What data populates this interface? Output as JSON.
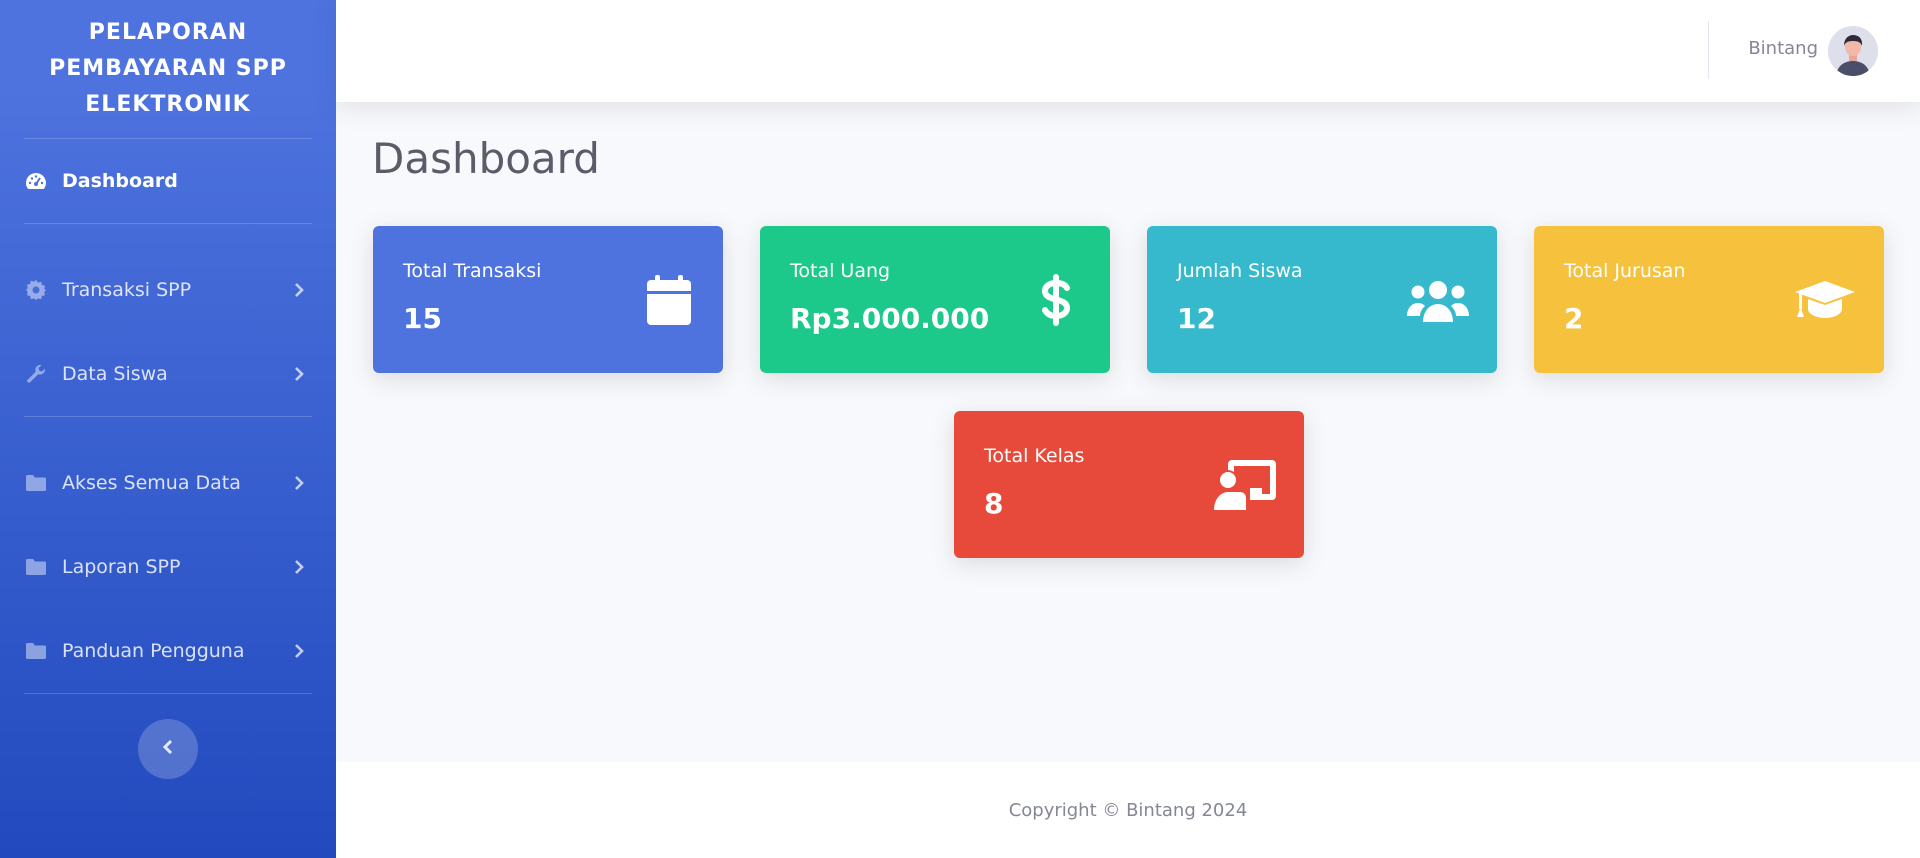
{
  "sidebar": {
    "brand": "PELAPORAN PEMBAYARAN SPP ELEKTRONIK",
    "items": [
      {
        "label": "Dashboard",
        "icon": "tachometer-icon",
        "active": true
      },
      {
        "label": "Transaksi SPP",
        "icon": "gear-icon"
      },
      {
        "label": "Data Siswa",
        "icon": "wrench-icon"
      },
      {
        "label": "Akses Semua Data",
        "icon": "folder-icon"
      },
      {
        "label": "Laporan SPP",
        "icon": "folder-icon"
      },
      {
        "label": "Panduan Pengguna",
        "icon": "folder-icon"
      }
    ],
    "toggle_icon": "chevron-left-icon"
  },
  "topbar": {
    "user_name": "Bintang",
    "avatar_icon": "user-avatar"
  },
  "main": {
    "title": "Dashboard",
    "cards": [
      {
        "label": "Total Transaksi",
        "value": "15",
        "icon": "calendar-icon",
        "color": "#4e73df"
      },
      {
        "label": "Total Uang",
        "value": "Rp3.000.000",
        "icon": "dollar-icon",
        "color": "#1cc88a"
      },
      {
        "label": "Jumlah Siswa",
        "value": "12",
        "icon": "users-icon",
        "color": "#36b9cc"
      },
      {
        "label": "Total Jurusan",
        "value": "2",
        "icon": "graduation-cap-icon",
        "color": "#f6c23e"
      },
      {
        "label": "Total Kelas",
        "value": "8",
        "icon": "chalkboard-teacher-icon",
        "color": "#e74a3b"
      }
    ]
  },
  "footer": {
    "text": "Copyright © Bintang 2024"
  }
}
